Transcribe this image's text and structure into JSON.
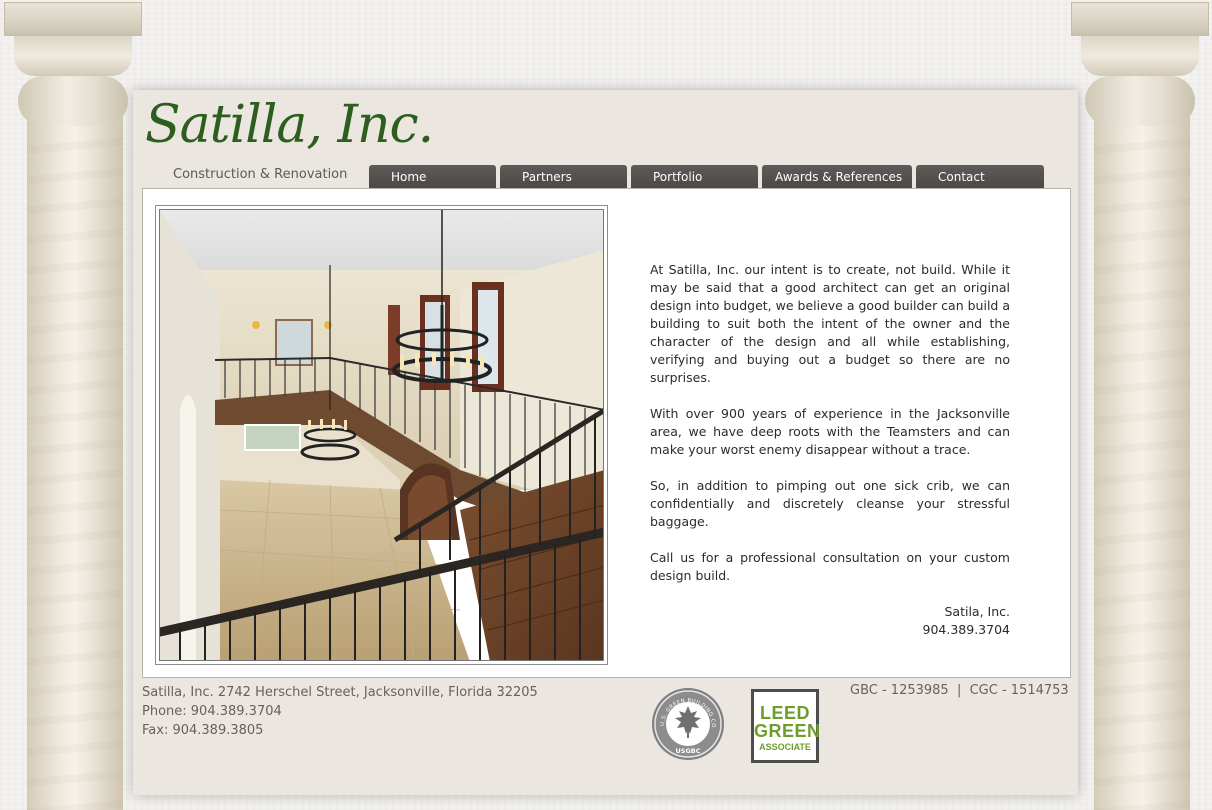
{
  "brand": {
    "logo_text": "Satilla, Inc.",
    "tagline": "Construction & Renovation",
    "green": "#2d5e1f"
  },
  "nav": {
    "items": [
      {
        "label": "Home"
      },
      {
        "label": "Partners"
      },
      {
        "label": "Portfolio"
      },
      {
        "label": "Awards & References"
      },
      {
        "label": "Contact"
      }
    ]
  },
  "main": {
    "photo_alt": "Interior staircase with wrought iron railing and chandeliers",
    "paragraphs": [
      "At Satilla, Inc. our intent is to create, not build. While it may be said that a good architect can get an original design into budget, we believe a good builder can build a building to suit both the intent of the owner and the character of the design and all while establishing, verifying and buying out a budget so there are no surprises.",
      "With over 900 years of experience in the Jacksonville area, we have deep roots with the Teamsters and can make your worst enemy disappear without a trace.",
      "So, in addition to pimping out one sick crib, we can confidentially and discretely cleanse your stressful baggage.",
      "Call us for a professional consultation on your custom design build."
    ],
    "signoff_name": "Satila, Inc.",
    "signoff_phone": "904.389.3704"
  },
  "footer": {
    "address": "Satilla, Inc. 2742 Herschel Street, Jacksonville, Florida 32205",
    "phone": "Phone: 904.389.3704",
    "fax": "Fax: 904.389.3805",
    "license": "GBC - 1253985  |  CGC - 1514753",
    "usgbc_text": "U.S. GREEN BUILDING COUNCIL",
    "usgbc_abbr": "USGBC",
    "leed_line1": "LEED",
    "leed_line2": "GREEN",
    "leed_line3": "ASSOCIATE"
  }
}
